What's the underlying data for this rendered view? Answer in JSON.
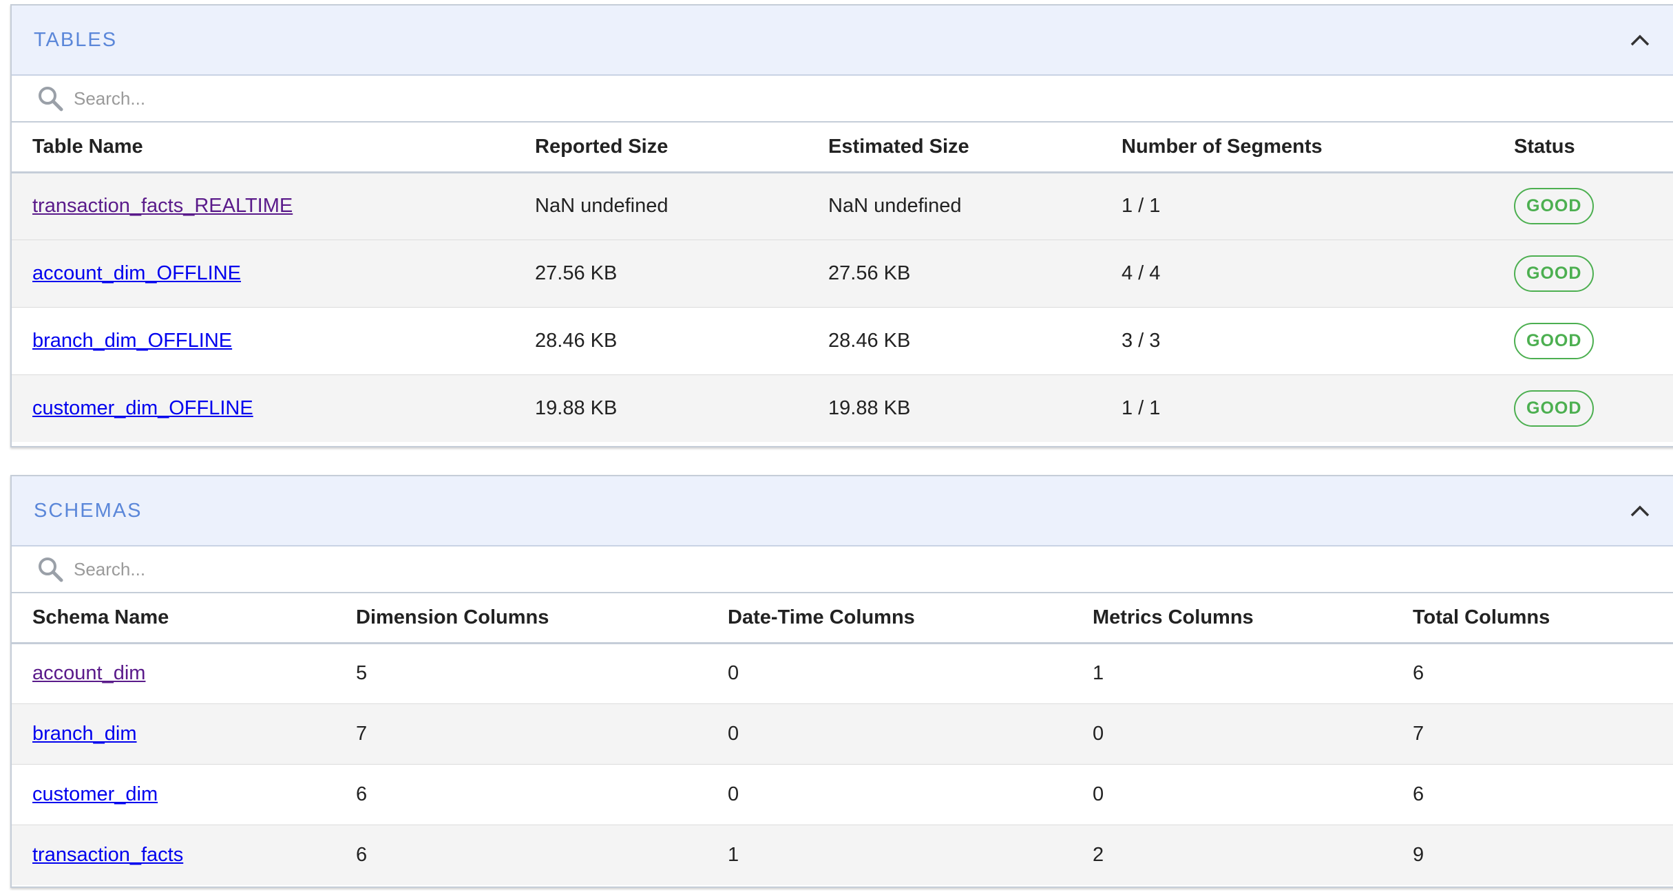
{
  "tables_section": {
    "title": "TABLES",
    "search_placeholder": "Search...",
    "columns": [
      "Table Name",
      "Reported Size",
      "Estimated Size",
      "Number of Segments",
      "Status"
    ],
    "rows": [
      {
        "name": "transaction_facts_REALTIME",
        "reported": "NaN undefined",
        "estimated": "NaN undefined",
        "segments": "1 / 1",
        "status": "GOOD"
      },
      {
        "name": "account_dim_OFFLINE",
        "reported": "27.56 KB",
        "estimated": "27.56 KB",
        "segments": "4 / 4",
        "status": "GOOD"
      },
      {
        "name": "branch_dim_OFFLINE",
        "reported": "28.46 KB",
        "estimated": "28.46 KB",
        "segments": "3 / 3",
        "status": "GOOD"
      },
      {
        "name": "customer_dim_OFFLINE",
        "reported": "19.88 KB",
        "estimated": "19.88 KB",
        "segments": "1 / 1",
        "status": "GOOD"
      }
    ]
  },
  "schemas_section": {
    "title": "SCHEMAS",
    "search_placeholder": "Search...",
    "columns": [
      "Schema Name",
      "Dimension Columns",
      "Date-Time Columns",
      "Metrics Columns",
      "Total Columns"
    ],
    "rows": [
      {
        "name": "account_dim",
        "dimension": "5",
        "datetime": "0",
        "metrics": "1",
        "total": "6"
      },
      {
        "name": "branch_dim",
        "dimension": "7",
        "datetime": "0",
        "metrics": "0",
        "total": "7"
      },
      {
        "name": "customer_dim",
        "dimension": "6",
        "datetime": "0",
        "metrics": "0",
        "total": "6"
      },
      {
        "name": "transaction_facts",
        "dimension": "6",
        "datetime": "1",
        "metrics": "2",
        "total": "9"
      }
    ]
  },
  "colors": {
    "header_bg": "#ecf1fc",
    "title": "#5b87d9",
    "status_good": "#4caf50",
    "link": "#0000ee",
    "link_visited": "#5a1a8a"
  },
  "icons": {
    "collapse": "chevron-up-icon",
    "search": "search-icon"
  }
}
